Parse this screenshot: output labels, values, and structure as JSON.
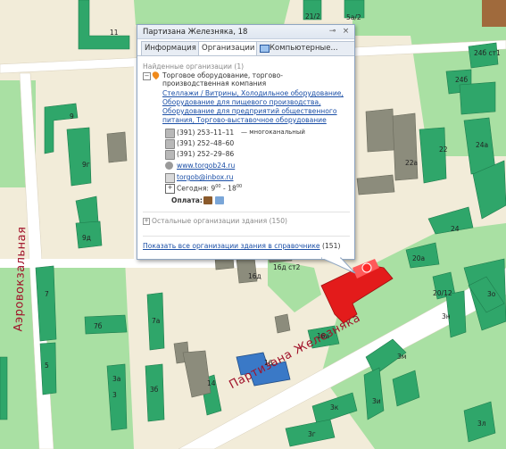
{
  "popup": {
    "title": "Партизана Железняка, 18",
    "tabs": [
      {
        "label": "Информация",
        "active": false
      },
      {
        "label": "Организации",
        "active": true
      },
      {
        "label": "Компьютерные...",
        "active": false
      }
    ],
    "found_label": "Найденные организации (1)",
    "org_name_line1": "Торговое оборудование, торгово-",
    "org_name_line2": "производственная компания",
    "categories": [
      "Стеллажи / Витрины, Холодильное оборудование,",
      "Оборудование для пищевого производства,",
      "Оборудование для предприятий общественного",
      "питания, Торгово-выставочное оборудование"
    ],
    "phones": [
      {
        "number": "(391) 253–11–11",
        "note": "— многоканальный"
      },
      {
        "number": "(391) 252–48–60",
        "note": ""
      },
      {
        "number": "(391) 252–29–86",
        "note": ""
      }
    ],
    "website": "www.torgob24.ru",
    "email": "torgob@inbox.ru",
    "hours": {
      "prefix": "Сегодня:",
      "from_h": "9",
      "from_m": "00",
      "to_h": "18",
      "to_m": "00"
    },
    "payment_label": "Оплата:",
    "other_orgs": "Остальные организации здания (150)",
    "show_all": "Показать все организации здания в справочнике",
    "show_all_count": "(151)"
  },
  "map": {
    "streets": [
      {
        "name": "Аэровокзальная"
      },
      {
        "name": "Партизана Железняка"
      }
    ],
    "building_labels": [
      "11",
      "21/2",
      "5а/2",
      "24б ст1",
      "24б",
      "9",
      "9г",
      "9д",
      "22а",
      "24а",
      "24",
      "22",
      "20а",
      "16д ст2",
      "16д",
      "16а",
      "16",
      "14",
      "7",
      "7а",
      "7б",
      "3",
      "3а",
      "3б",
      "5",
      "3м",
      "3л",
      "3и",
      "3к",
      "3г",
      "3о",
      "3н",
      "20/12"
    ],
    "colors": {
      "background": "#f2ecd9",
      "park": "#a9e0a3",
      "building": "#2fa66a",
      "building_gray": "#8c8c7c",
      "selected": "#e31b1b",
      "highlight": "#3a79c7",
      "street": "#ffffff"
    }
  }
}
